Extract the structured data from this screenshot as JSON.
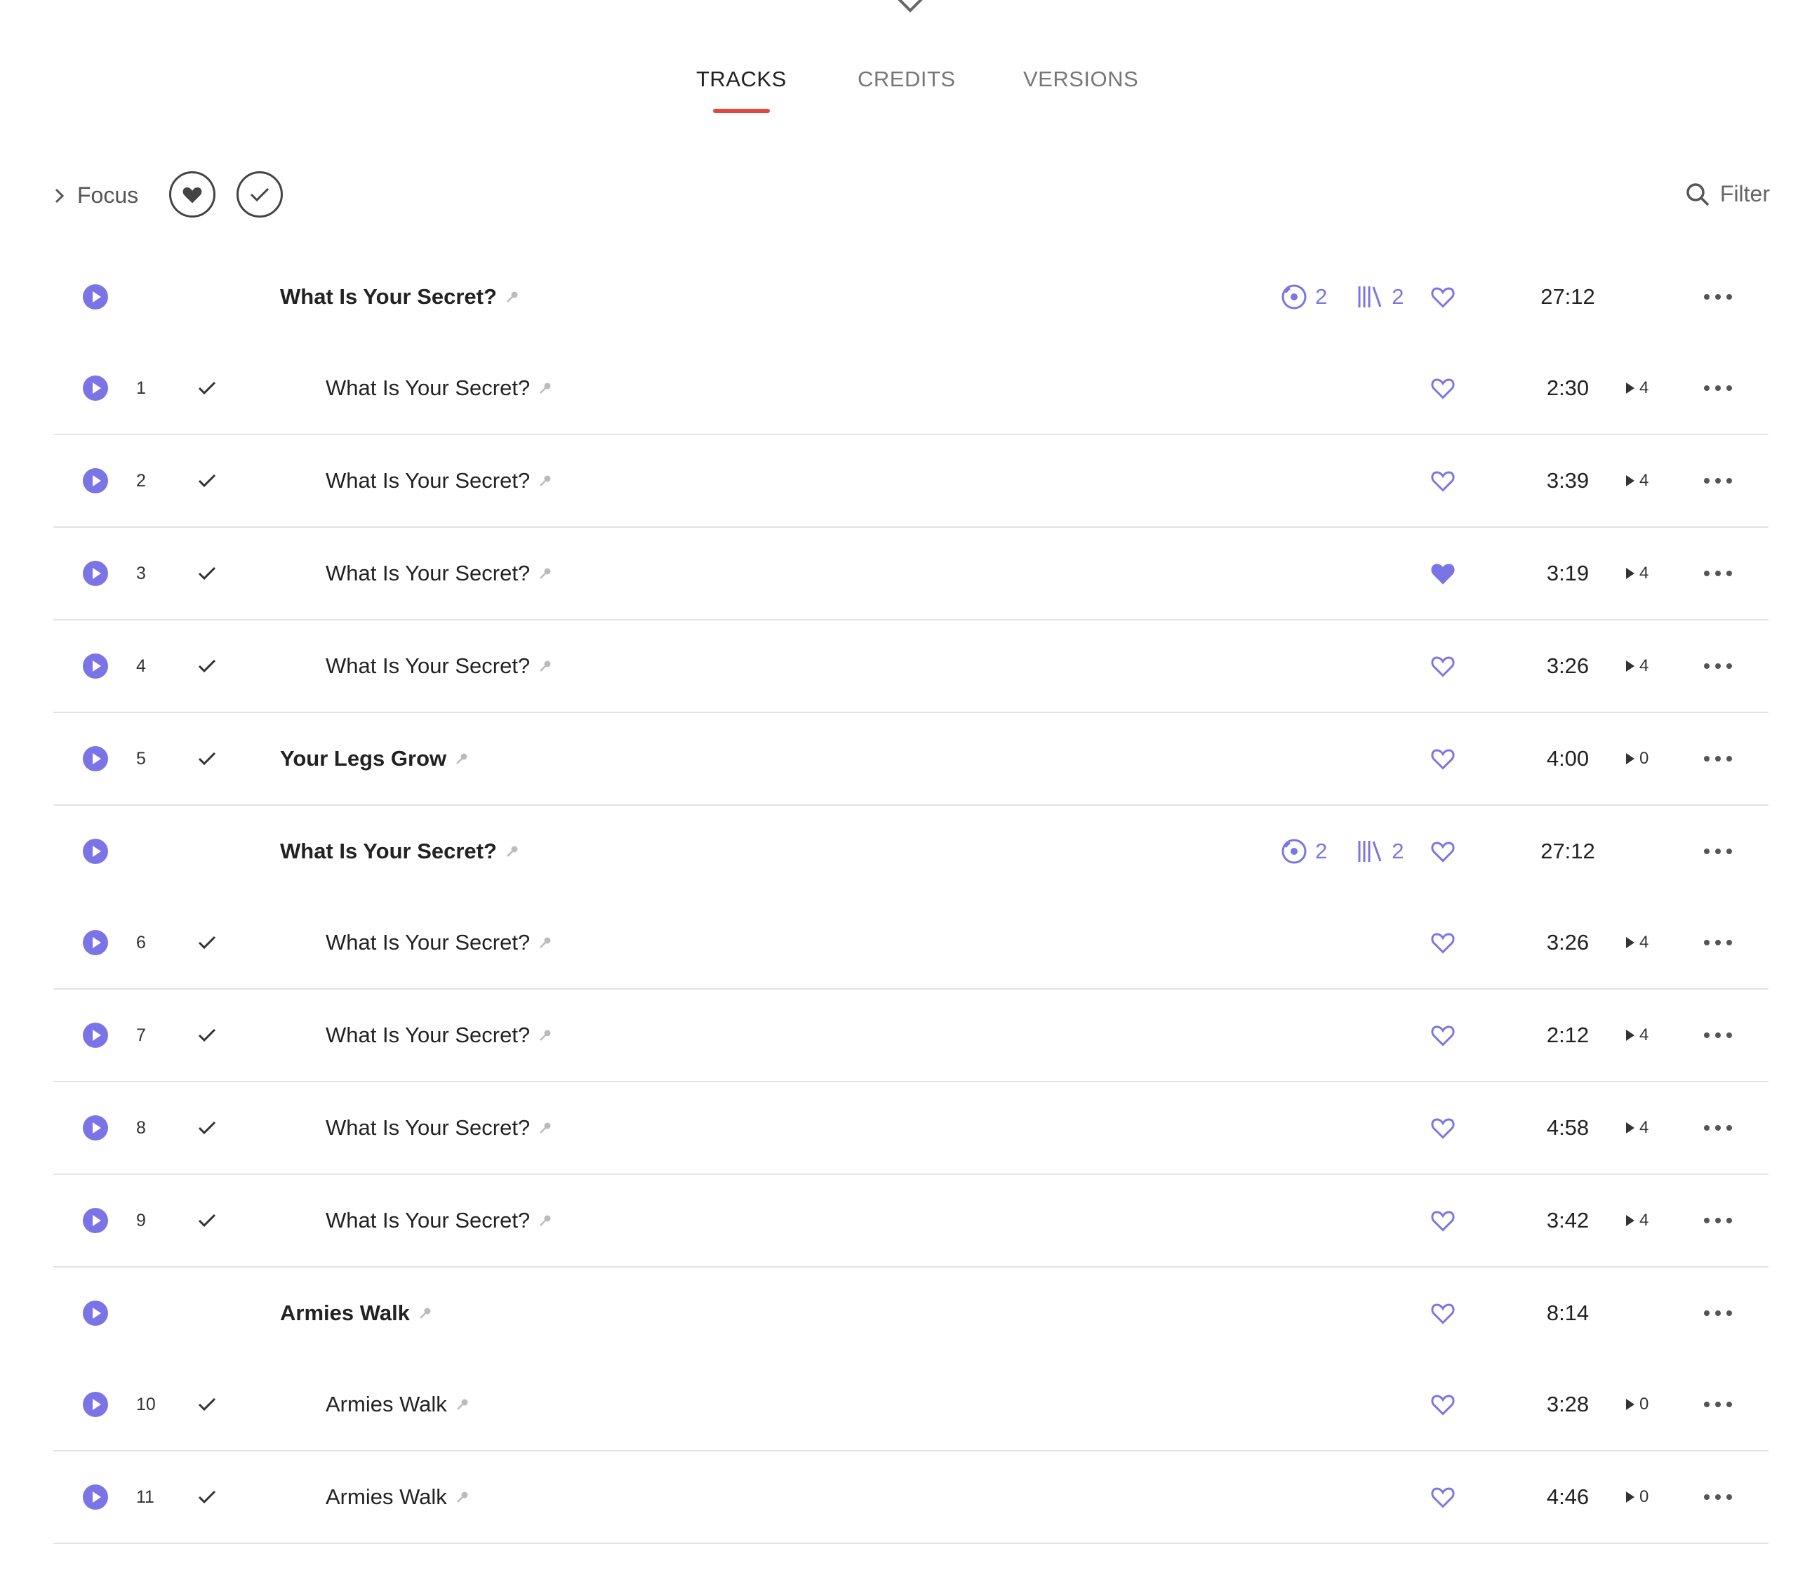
{
  "tabs": [
    {
      "label": "TRACKS",
      "active": true
    },
    {
      "label": "CREDITS",
      "active": false
    },
    {
      "label": "VERSIONS",
      "active": false
    }
  ],
  "toolbar": {
    "focus_label": "Focus",
    "filter_label": "Filter"
  },
  "colors": {
    "accent": "#7b74e6",
    "tab_underline": "#e2483d"
  },
  "rows": [
    {
      "kind": "group",
      "title": "What Is Your Secret?",
      "discs": "2",
      "versions": "2",
      "favorite": false,
      "duration": "27:12"
    },
    {
      "kind": "track",
      "number": "1",
      "title": "What Is Your Secret?",
      "favorite": false,
      "duration": "2:30",
      "plays": "4"
    },
    {
      "kind": "track",
      "number": "2",
      "title": "What Is Your Secret?",
      "favorite": false,
      "duration": "3:39",
      "plays": "4"
    },
    {
      "kind": "track",
      "number": "3",
      "title": "What Is Your Secret?",
      "favorite": true,
      "duration": "3:19",
      "plays": "4"
    },
    {
      "kind": "track",
      "number": "4",
      "title": "What Is Your Secret?",
      "favorite": false,
      "duration": "3:26",
      "plays": "4"
    },
    {
      "kind": "single",
      "number": "5",
      "title": "Your Legs Grow",
      "favorite": false,
      "duration": "4:00",
      "plays": "0"
    },
    {
      "kind": "group",
      "title": "What Is Your Secret?",
      "discs": "2",
      "versions": "2",
      "favorite": false,
      "duration": "27:12"
    },
    {
      "kind": "track",
      "number": "6",
      "title": "What Is Your Secret?",
      "favorite": false,
      "duration": "3:26",
      "plays": "4"
    },
    {
      "kind": "track",
      "number": "7",
      "title": "What Is Your Secret?",
      "favorite": false,
      "duration": "2:12",
      "plays": "4"
    },
    {
      "kind": "track",
      "number": "8",
      "title": "What Is Your Secret?",
      "favorite": false,
      "duration": "4:58",
      "plays": "4"
    },
    {
      "kind": "track",
      "number": "9",
      "title": "What Is Your Secret?",
      "favorite": false,
      "duration": "3:42",
      "plays": "4"
    },
    {
      "kind": "group",
      "title": "Armies Walk",
      "favorite": false,
      "duration": "8:14"
    },
    {
      "kind": "track",
      "number": "10",
      "title": "Armies Walk",
      "favorite": false,
      "duration": "3:28",
      "plays": "0"
    },
    {
      "kind": "track",
      "number": "11",
      "title": "Armies Walk",
      "favorite": false,
      "duration": "4:46",
      "plays": "0"
    }
  ]
}
